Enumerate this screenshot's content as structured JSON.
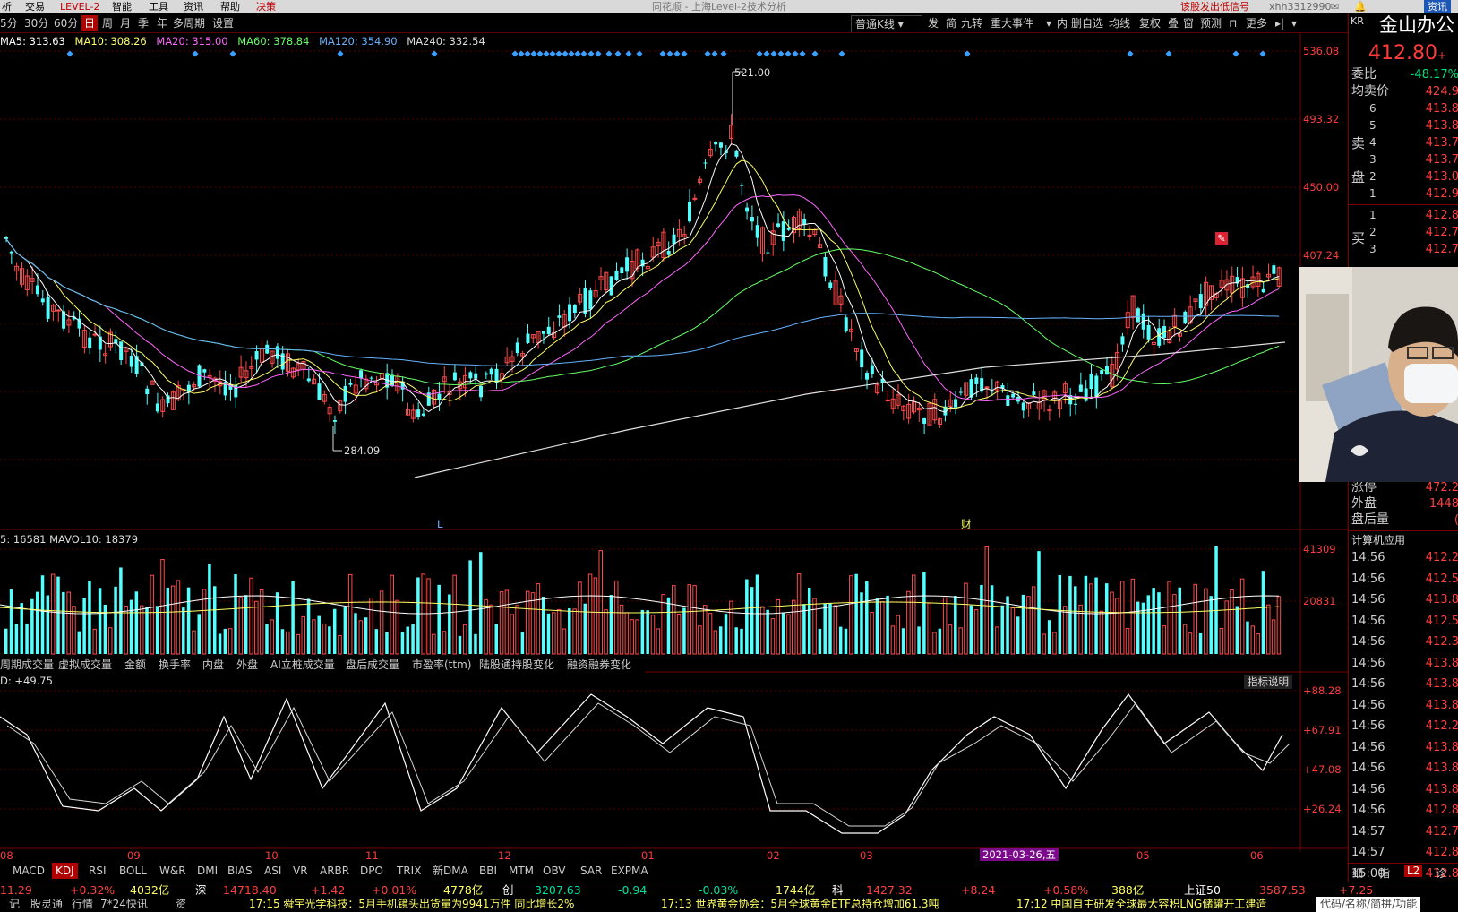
{
  "menubar": {
    "items": [
      "析",
      "交易",
      "LEVEL-2",
      "智能",
      "工具",
      "资讯",
      "帮助",
      "决策"
    ],
    "center_title": "同花顺 - 上海Level-2技术分析",
    "right_text": "该股发出低信号",
    "user": "xhh3312990",
    "right_btn": "资讯"
  },
  "toolbar": {
    "periods": [
      "5分",
      "30分",
      "60分",
      "日",
      "周",
      "月",
      "季",
      "年",
      "多周期",
      "设置"
    ],
    "active_period": "日",
    "kline_select": "普通K线",
    "tools": [
      "发",
      "简",
      "九转",
      "重大事件",
      "内",
      "删自选",
      "均线",
      "复权",
      "叠",
      "窗",
      "预测",
      "更多"
    ]
  },
  "ma_legend": [
    {
      "label": "MA5: 313.63",
      "color": "#ffffff"
    },
    {
      "label": "MA10: 308.26",
      "color": "#ffff66"
    },
    {
      "label": "MA20: 315.00",
      "color": "#ff66ff"
    },
    {
      "label": "MA60: 378.84",
      "color": "#66ff66"
    },
    {
      "label": "MA120: 354.90",
      "color": "#66b3ff"
    },
    {
      "label": "MA240: 332.54",
      "color": "#d0d0d0"
    }
  ],
  "price_axis": {
    "labels": [
      "536.08",
      "493.32",
      "450.00",
      "407.24"
    ],
    "color": "#ff3b3b"
  },
  "annotations": {
    "high": "521.00",
    "low": "284.09",
    "marker_L": "L",
    "marker_cai": "财"
  },
  "volume": {
    "legend": "5: 16581  MAVOL10: 18379",
    "axis": [
      "41309",
      "20831"
    ]
  },
  "volume_tabs": [
    "周期成交量",
    "虚拟成交量",
    "金额",
    "换手率",
    "内盘",
    "外盘",
    "AI立桩成交量",
    "盘后成交量",
    "市盈率(ttm)",
    "陆股通持股变化",
    "融资融券变化"
  ],
  "kdj": {
    "legend": "D: +49.75",
    "help": "指标说明",
    "axis": [
      "+88.28",
      "+67.91",
      "+47.08",
      "+26.24"
    ]
  },
  "date_axis": {
    "labels": [
      "08",
      "09",
      "10",
      "11",
      "12",
      "01",
      "02",
      "03",
      "05",
      "06"
    ],
    "highlight": "2021-03-26,五"
  },
  "indicator_tabs": [
    "MACD",
    "KDJ",
    "RSI",
    "BOLL",
    "W&R",
    "DMI",
    "BIAS",
    "ASI",
    "VR",
    "ARBR",
    "DPO",
    "TRIX",
    "新DMA",
    "BBI",
    "MTM",
    "OBV",
    "SAR",
    "EXPMA"
  ],
  "active_indicator": "KDJ",
  "quote": {
    "side_label": "KR",
    "name": "金山办公",
    "price": "412.80",
    "price_suffix": "+",
    "wei_bi_label": "委比",
    "wei_bi": "-48.17%",
    "avg_sell_label": "均卖价",
    "avg_sell": "424.9",
    "sell_label": "卖盘",
    "sell": [
      {
        "n": "6",
        "p": "413.8"
      },
      {
        "n": "5",
        "p": "413.8"
      },
      {
        "n": "4",
        "p": "413.7"
      },
      {
        "n": "3",
        "p": "413.7"
      },
      {
        "n": "2",
        "p": "413.0"
      },
      {
        "n": "1",
        "p": "412.9"
      }
    ],
    "buy_label": "买",
    "buy": [
      {
        "n": "1",
        "p": "412.8"
      },
      {
        "n": "2",
        "p": "412.7"
      },
      {
        "n": "3",
        "p": "412.7"
      }
    ],
    "extra": [
      {
        "l": "涨停",
        "v": "472.2"
      },
      {
        "l": "外盘",
        "v": "1448"
      },
      {
        "l": "盘后量",
        "v": "("
      }
    ],
    "sector": "计算机应用",
    "trades": [
      {
        "t": "14:56",
        "p": "412.2"
      },
      {
        "t": "14:56",
        "p": "412.5"
      },
      {
        "t": "14:56",
        "p": "413.8"
      },
      {
        "t": "14:56",
        "p": "412.5"
      },
      {
        "t": "14:56",
        "p": "412.3"
      },
      {
        "t": "14:56",
        "p": "413.8"
      },
      {
        "t": "14:56",
        "p": "413.8"
      },
      {
        "t": "14:56",
        "p": "413.8"
      },
      {
        "t": "14:56",
        "p": "412.2"
      },
      {
        "t": "14:56",
        "p": "413.8"
      },
      {
        "t": "14:56",
        "p": "413.8"
      },
      {
        "t": "14:56",
        "p": "413.8"
      },
      {
        "t": "14:56",
        "p": "412.8"
      },
      {
        "t": "14:57",
        "p": "412.7"
      },
      {
        "t": "14:57",
        "p": "412.8"
      },
      {
        "t": "15:00",
        "p": "412.8"
      }
    ],
    "bottom_tabs": [
      "细",
      "指",
      "L2",
      "诊"
    ]
  },
  "ticker": [
    {
      "t": "11.29",
      "c": "#ff4040"
    },
    {
      "t": "+0.32%",
      "c": "#ff4040"
    },
    {
      "t": "4032亿",
      "c": "#ffff66"
    },
    {
      "t": "深",
      "c": "#ffffff"
    },
    {
      "t": "14718.40",
      "c": "#ff4040"
    },
    {
      "t": "+1.42",
      "c": "#ff4040"
    },
    {
      "t": "+0.01%",
      "c": "#ff4040"
    },
    {
      "t": "4778亿",
      "c": "#ffff66"
    },
    {
      "t": "创",
      "c": "#ffffff"
    },
    {
      "t": "3207.63",
      "c": "#00e0a0"
    },
    {
      "t": "-0.94",
      "c": "#00e0a0"
    },
    {
      "t": "-0.03%",
      "c": "#00e0a0"
    },
    {
      "t": "1744亿",
      "c": "#ffff66"
    },
    {
      "t": "科",
      "c": "#ffffff"
    },
    {
      "t": "1427.32",
      "c": "#ff4040"
    },
    {
      "t": "+8.24",
      "c": "#ff4040"
    },
    {
      "t": "+0.58%",
      "c": "#ff4040"
    },
    {
      "t": "388亿",
      "c": "#ffff66"
    },
    {
      "t": "上证50",
      "c": "#ffffff"
    },
    {
      "t": "3587.53",
      "c": "#ff4040"
    },
    {
      "t": "+7.25",
      "c": "#ff4040"
    }
  ],
  "news": [
    {
      "t": "记",
      "c": "#ccc"
    },
    {
      "t": "股灵通",
      "c": "#ccc"
    },
    {
      "t": "行情",
      "c": "#ccc"
    },
    {
      "t": "7*24快讯",
      "c": "#ccc"
    },
    {
      "t": "资",
      "c": "#ccc"
    },
    {
      "t": "17:15 舜宇光学科技：5月手机镜头出货量为9941万件 同比增长2%",
      "c": "#ffff66"
    },
    {
      "t": "17:13 世界黄金协会：5月全球黄金ETF总持仓增加61.3吨",
      "c": "#ffff66"
    },
    {
      "t": "17:12 中国自主研发全球最大容积LNG储罐开工建造",
      "c": "#ffff66"
    },
    {
      "t": "代码/名称/简拼/功能",
      "c": "#aaa"
    }
  ]
}
